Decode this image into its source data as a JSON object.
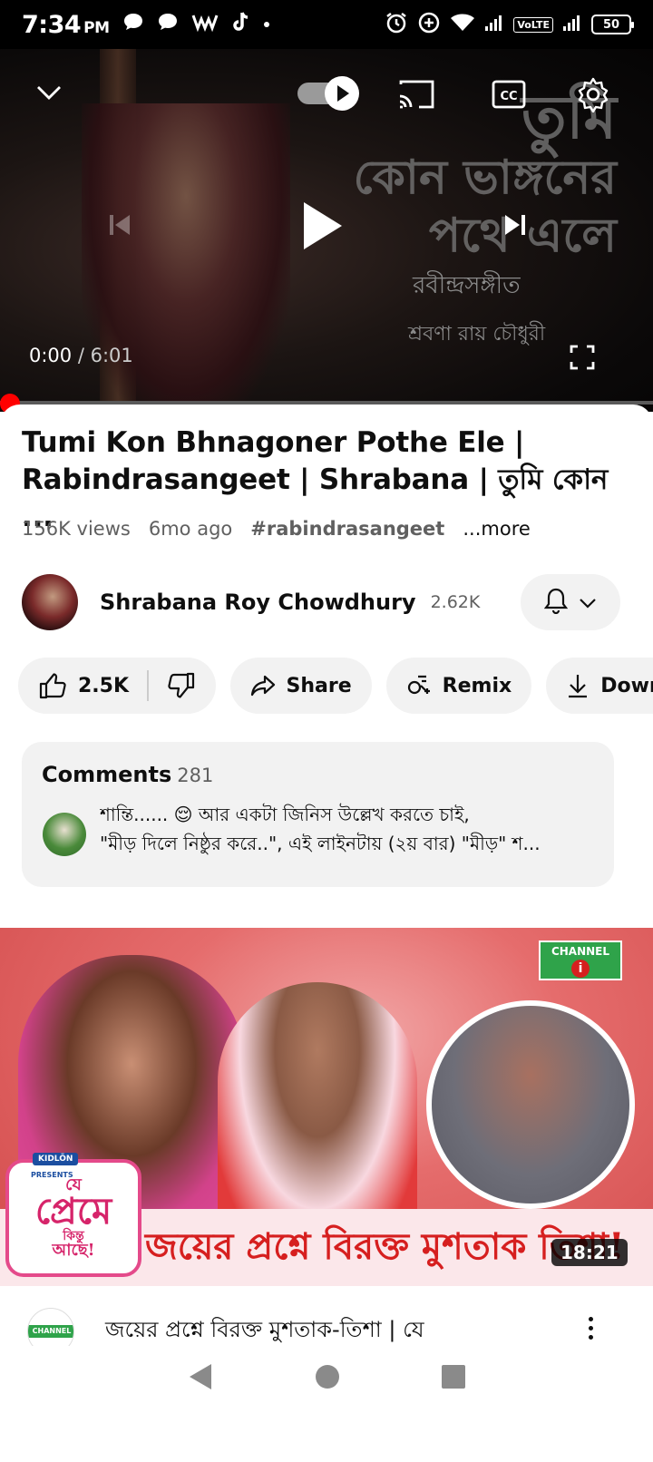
{
  "status_bar": {
    "time": "7:34",
    "ampm": "PM",
    "network": "VoLTE",
    "battery": "50"
  },
  "player": {
    "overlay_line1": "তুমি",
    "overlay_line2": "কোন ভাঙ্গনের",
    "overlay_line3": "পথে এলে",
    "overlay_genre": "রবীন্দ্রসঙ্গীত",
    "overlay_artist": "শ্রবণা রায় চৌধুরী",
    "current_time": "0:00",
    "separator": " / ",
    "duration": "6:01",
    "progress": 0.0
  },
  "video": {
    "title": "Tumi Kon Bhnagoner Pothe Ele | Rabindrasangeet | Shrabana | তুমি কোন ...",
    "views": "156K views",
    "age": "6mo ago",
    "hashtag": "#rabindrasangeet",
    "more": "...more"
  },
  "channel": {
    "name": "Shrabana Roy Chowdhury",
    "subscribers": "2.62K"
  },
  "actions": {
    "likes": "2.5K",
    "share": "Share",
    "remix": "Remix",
    "download": "Down"
  },
  "comments": {
    "label": "Comments",
    "count": "281",
    "top_comment_line1": "শান্তি...... 😌 আর একটা জিনিস উল্লেখ করতে চাই,",
    "top_comment_line2": "\"মীড় দিলে নিষ্ঠুর করে..\", এই লাইনটায় (২য় বার) \"মীড়\" শ..."
  },
  "next_video": {
    "thumbnail_banner": "জয়ের প্রশ্নে বিরক্ত মুশতাক তিশা!",
    "show_logo": "প্রেমে",
    "show_logo_top": "যে",
    "show_logo_bottom": "আছে!",
    "show_logo_mid": "কিন্তু",
    "sponsor": "KIDLÖN",
    "presents": "PRESENTS",
    "channel_logo": "CHANNEL",
    "channel_logo_num": "i",
    "duration": "18:21",
    "title": "জয়ের প্রশ্নে বিরক্ত মুশতাক-তিশা | যে",
    "channel_avatar": "CHANNEL"
  },
  "colors": {
    "accent_red": "#ff0000",
    "pill_bg": "#f2f2f2",
    "text_secondary": "#606060"
  }
}
